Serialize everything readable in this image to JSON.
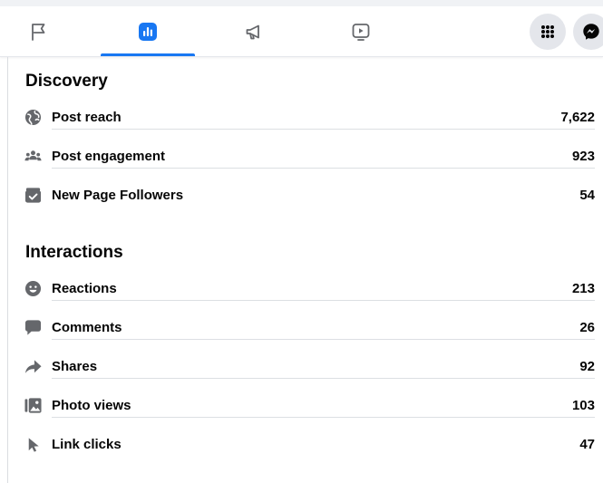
{
  "nav": {
    "tabs": [
      {
        "id": "flag",
        "icon": "flag-icon",
        "active": false
      },
      {
        "id": "insights",
        "icon": "bar-chart-icon",
        "active": true
      },
      {
        "id": "ads",
        "icon": "megaphone-icon",
        "active": false
      },
      {
        "id": "video",
        "icon": "video-play-icon",
        "active": false
      }
    ],
    "menu_icon": "grid-menu-icon",
    "messenger_icon": "messenger-icon"
  },
  "discovery": {
    "title": "Discovery",
    "rows": [
      {
        "label": "Post reach",
        "value": "7,622",
        "icon": "globe-icon"
      },
      {
        "label": "Post engagement",
        "value": "923",
        "icon": "people-icon"
      },
      {
        "label": "New Page Followers",
        "value": "54",
        "icon": "follow-check-icon"
      }
    ]
  },
  "interactions": {
    "title": "Interactions",
    "rows": [
      {
        "label": "Reactions",
        "value": "213",
        "icon": "smiley-icon"
      },
      {
        "label": "Comments",
        "value": "26",
        "icon": "comment-bubble-icon"
      },
      {
        "label": "Shares",
        "value": "92",
        "icon": "share-arrow-icon"
      },
      {
        "label": "Photo views",
        "value": "103",
        "icon": "photo-icon"
      },
      {
        "label": "Link clicks",
        "value": "47",
        "icon": "cursor-icon"
      }
    ]
  },
  "colors": {
    "accent": "#1877f2",
    "icon": "#65676b",
    "text": "#050505"
  }
}
